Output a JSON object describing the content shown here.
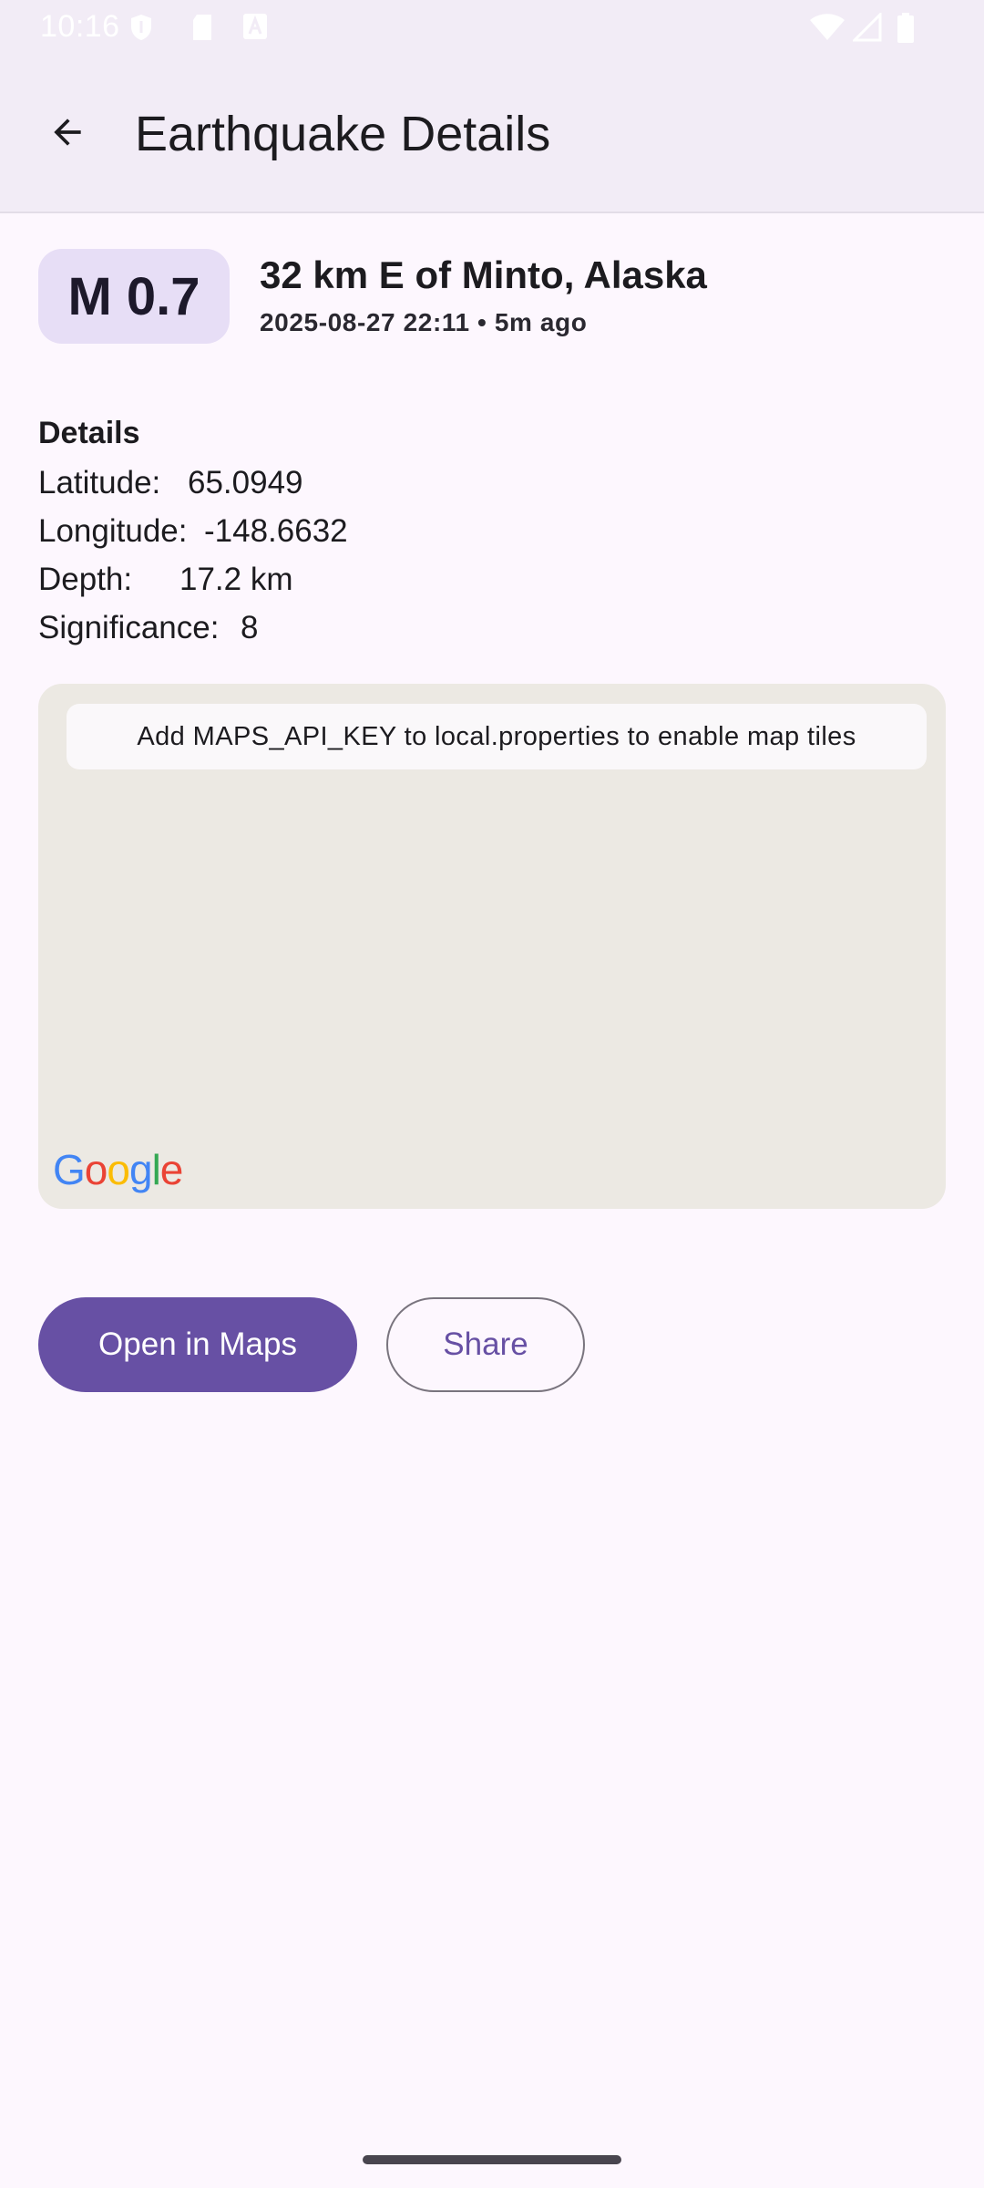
{
  "status_bar": {
    "time": "10:16",
    "left_icons": [
      "shield-icon",
      "sd-card-icon",
      "font-a-icon"
    ],
    "right_icons": [
      "wifi-icon",
      "signal-icon",
      "battery-icon"
    ]
  },
  "app_bar": {
    "title": "Earthquake Details",
    "back_icon": "arrow-back-icon"
  },
  "quake": {
    "magnitude_label": "M 0.7",
    "place": "32 km E of Minto, Alaska",
    "time_line": "2025-08-27 22:11 • 5m ago"
  },
  "details": {
    "title": "Details",
    "rows": [
      {
        "label": "Latitude:",
        "value": "65.0949"
      },
      {
        "label": "Longitude:",
        "value": "-148.6632"
      },
      {
        "label": "Depth:",
        "value": "17.2 km"
      },
      {
        "label": "Significance:",
        "value": "8"
      }
    ]
  },
  "map": {
    "notice": "Add MAPS_API_KEY to local.properties to enable map tiles",
    "logo_text": "Google"
  },
  "actions": {
    "open_in_maps": "Open in Maps",
    "share": "Share"
  },
  "colors": {
    "background": "#FDF7FE",
    "app_bar": "#F2ECF6",
    "badge": "#E7DEF6",
    "primary": "#6750A4",
    "map_bg": "#ECE9E3"
  }
}
